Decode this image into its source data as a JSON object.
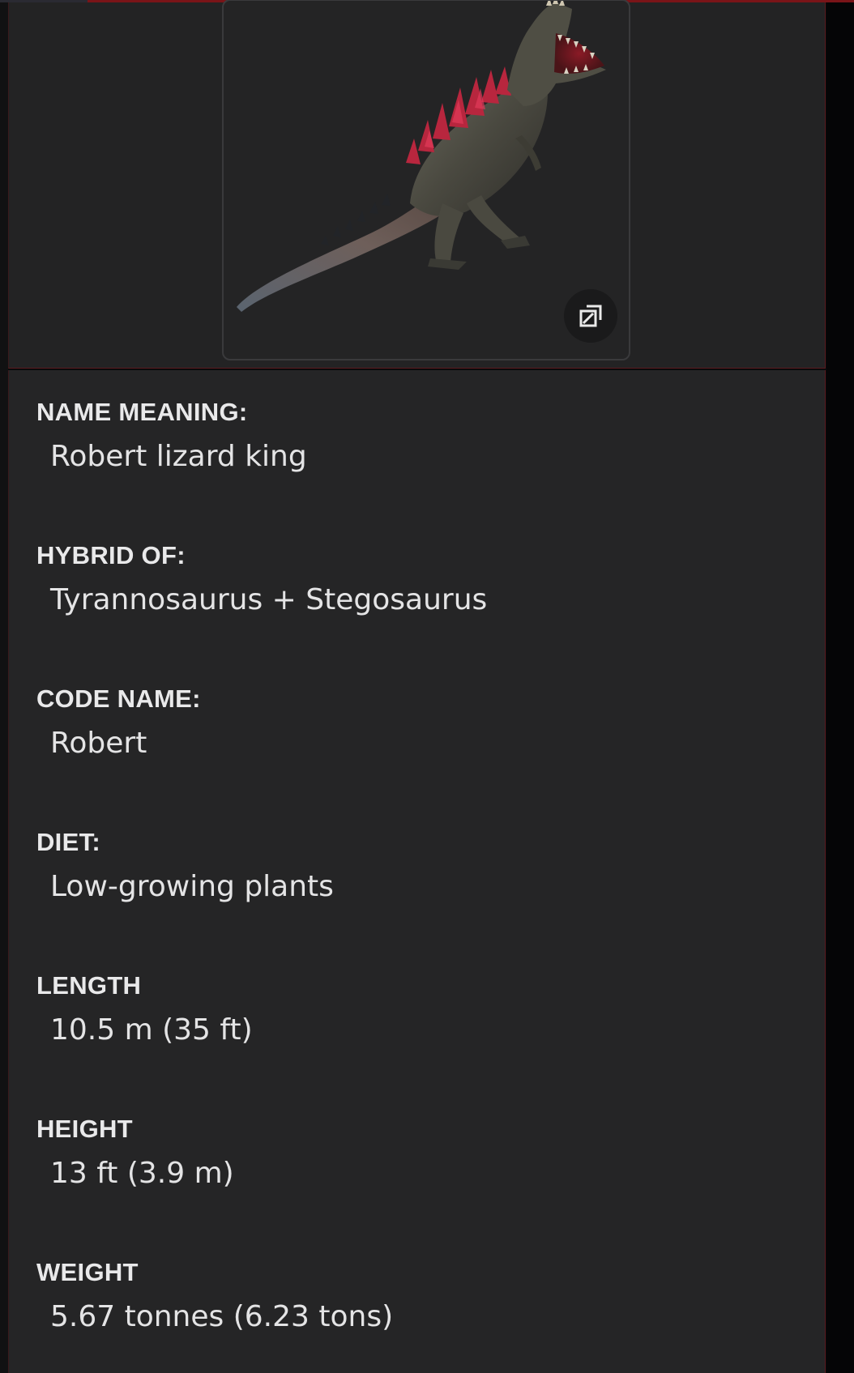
{
  "media": {
    "image_alt": "Hybrid dinosaur with red dorsal plates",
    "expand_icon": "expand-icon"
  },
  "colors": {
    "background": "#252526",
    "accent": "#7a1418",
    "text": "#e4e4e5"
  },
  "fields": [
    {
      "label": "NAME MEANING:",
      "value": "Robert lizard king"
    },
    {
      "label": "HYBRID OF:",
      "value": "Tyrannosaurus + Stegosaurus"
    },
    {
      "label": "CODE NAME:",
      "value": "Robert"
    },
    {
      "label": "DIET:",
      "value": "Low-growing plants"
    },
    {
      "label": "LENGTH",
      "value": "10.5 m (35 ft)"
    },
    {
      "label": "HEIGHT",
      "value": "13 ft (3.9 m)"
    },
    {
      "label": "WEIGHT",
      "value": "5.67 tonnes (6.23 tons)"
    }
  ]
}
